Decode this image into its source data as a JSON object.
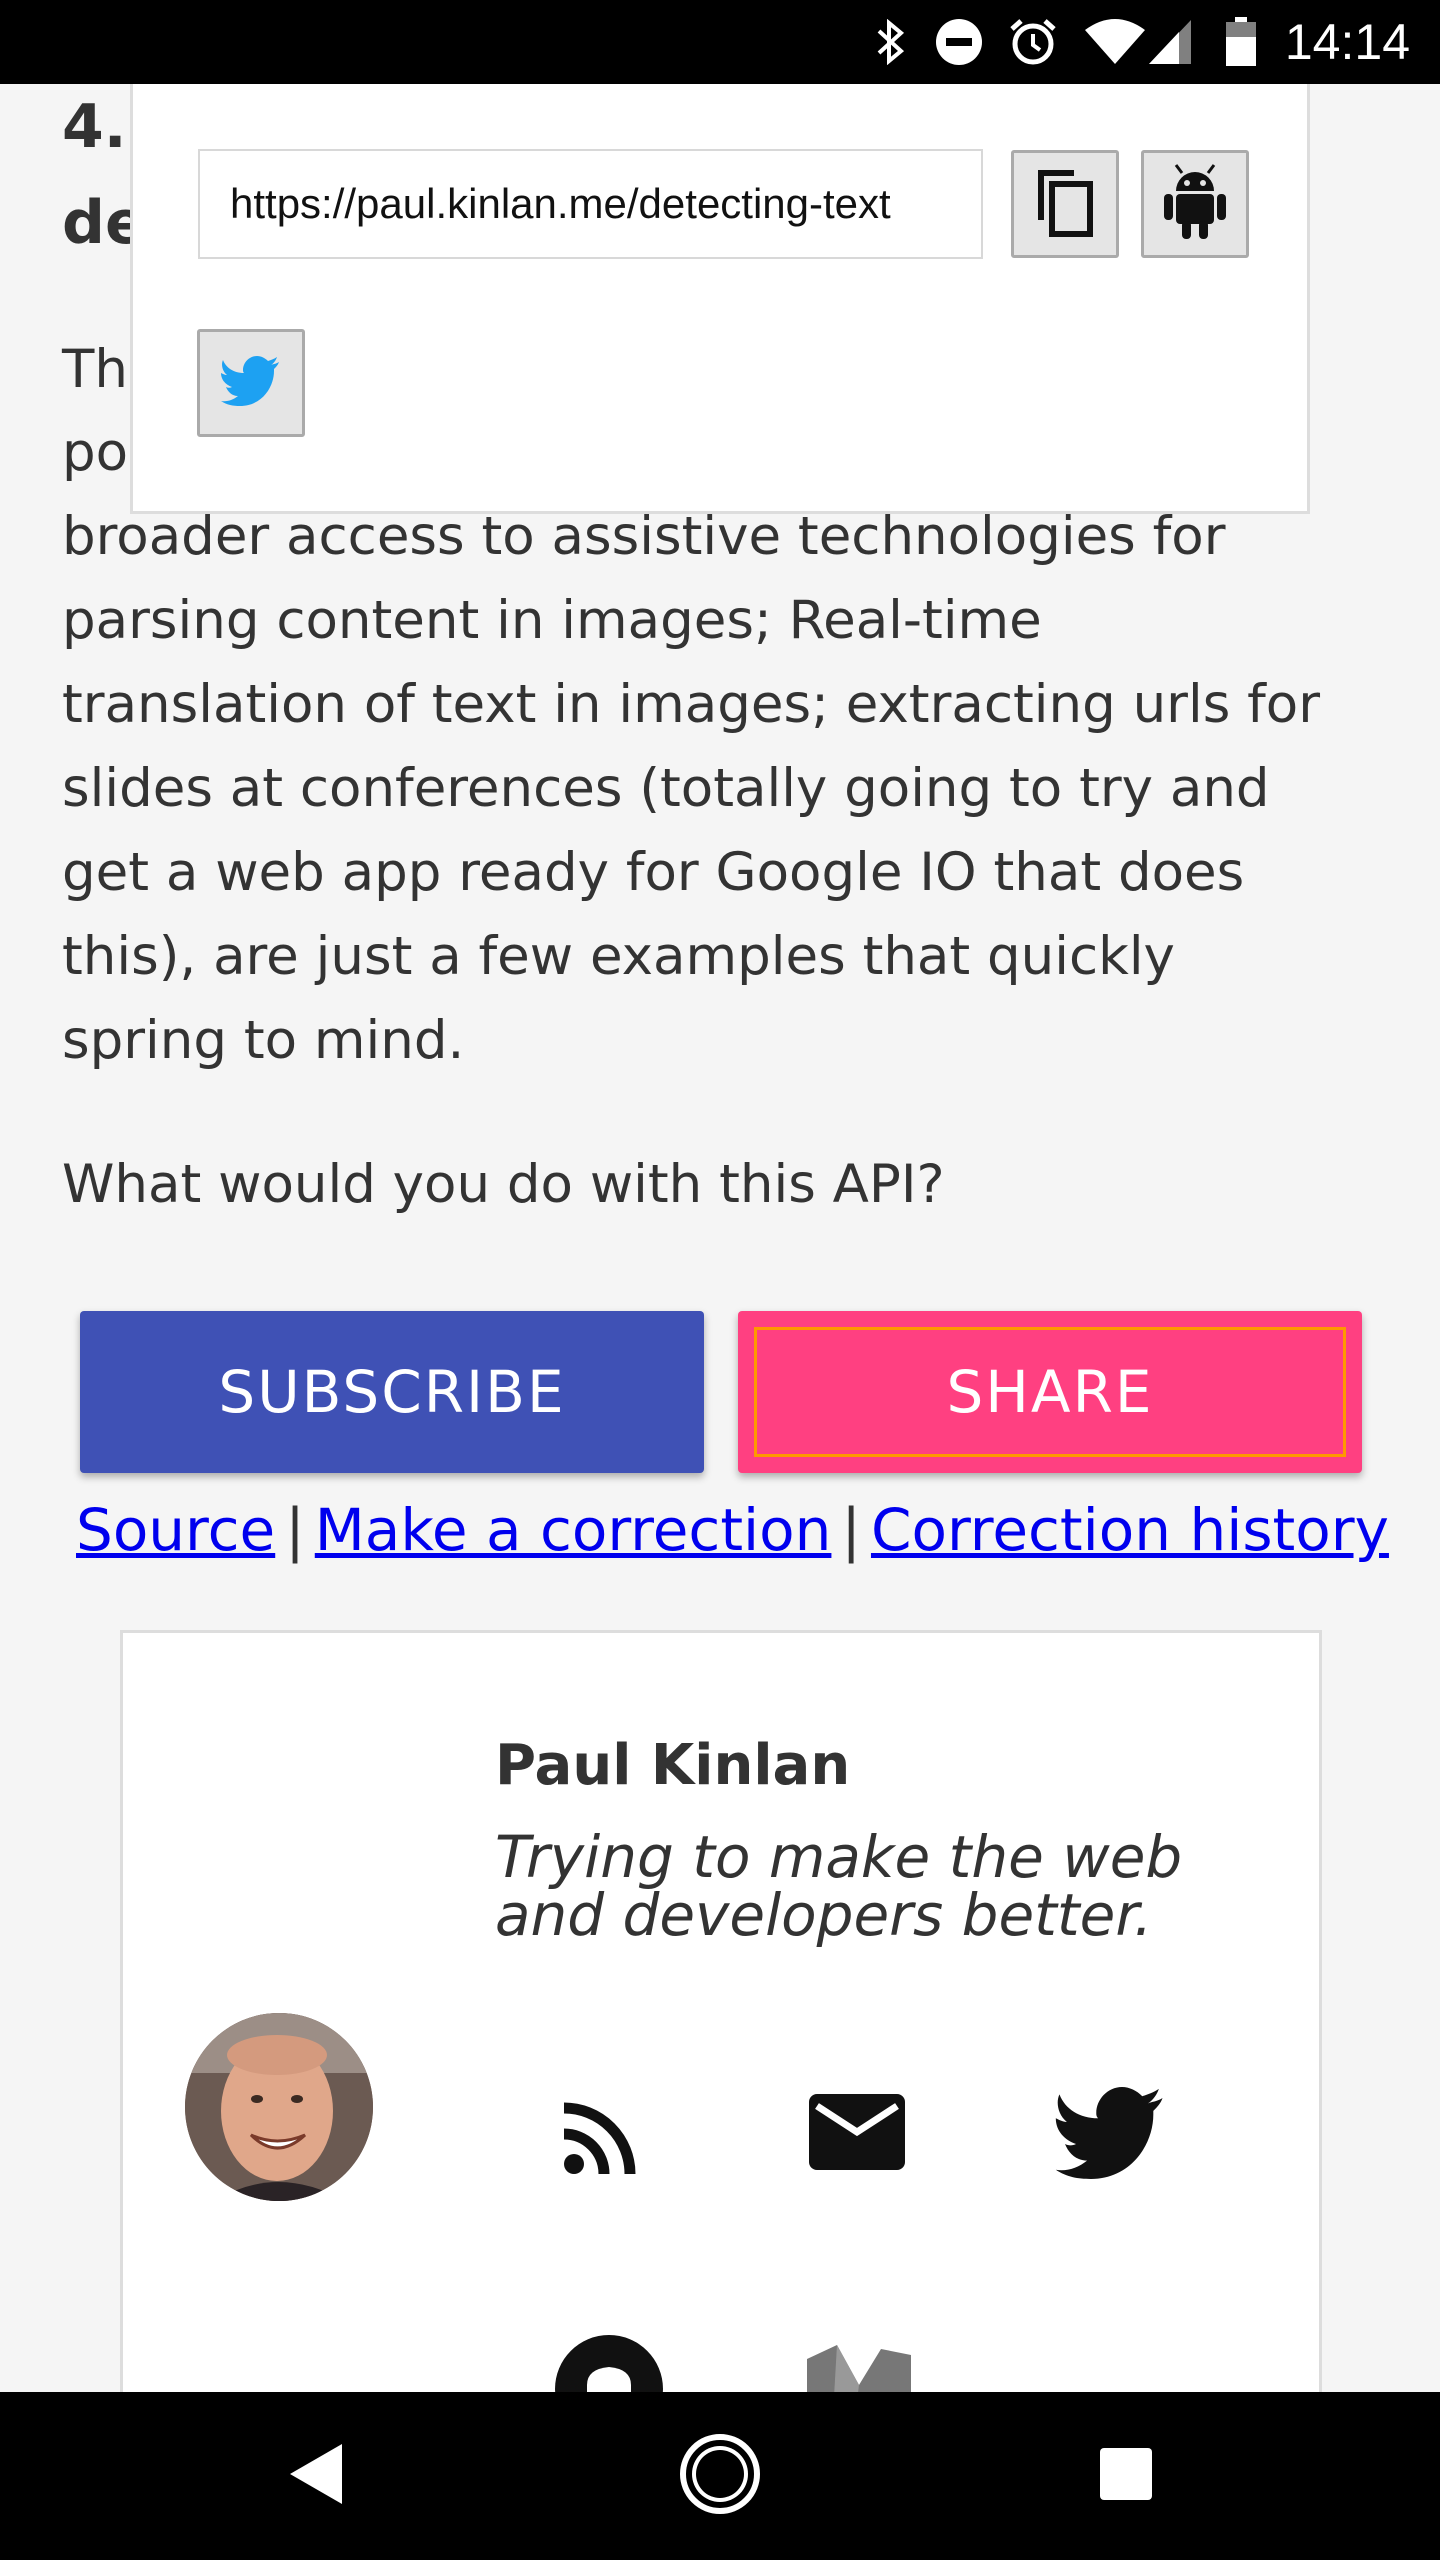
{
  "status_bar": {
    "time": "14:14",
    "icons": [
      "bluetooth-icon",
      "do-not-disturb-icon",
      "alarm-icon",
      "wifi-icon",
      "cell-signal-icon",
      "battery-icon"
    ]
  },
  "article": {
    "heading_fragment_1": "4.",
    "heading_fragment_2": "de",
    "para_fragment_1": "Th",
    "para_fragment_2": "po",
    "paragraph_lines": [
      "broader access to assistive technologies for",
      "parsing content in images; Real-time",
      "translation of text in images; extracting urls for",
      "slides at conferences (totally going to try and",
      "get a web app ready for Google IO that does",
      "this), are just a few examples that quickly",
      "spring to mind."
    ],
    "question": "What would you do with this API?"
  },
  "share_popup": {
    "url": "https://paul.kinlan.me/detecting-text",
    "copy_icon": "copy-icon",
    "android_icon": "android-icon",
    "twitter_icon": "twitter-icon"
  },
  "actions": {
    "subscribe_label": "SUBSCRIBE",
    "share_label": "SHARE"
  },
  "links": {
    "source": "Source",
    "separator": "|",
    "correction": "Make a correction",
    "history": "Correction history"
  },
  "author": {
    "name": "Paul Kinlan",
    "bio": "Trying to make the web and developers better.",
    "social_icons": [
      "rss-icon",
      "email-icon",
      "twitter-icon",
      "github-icon",
      "medium-icon"
    ]
  },
  "colors": {
    "subscribe": "#3f51b5",
    "share": "#ff4081",
    "link": "#0000ee",
    "twitter": "#1da1f2"
  }
}
